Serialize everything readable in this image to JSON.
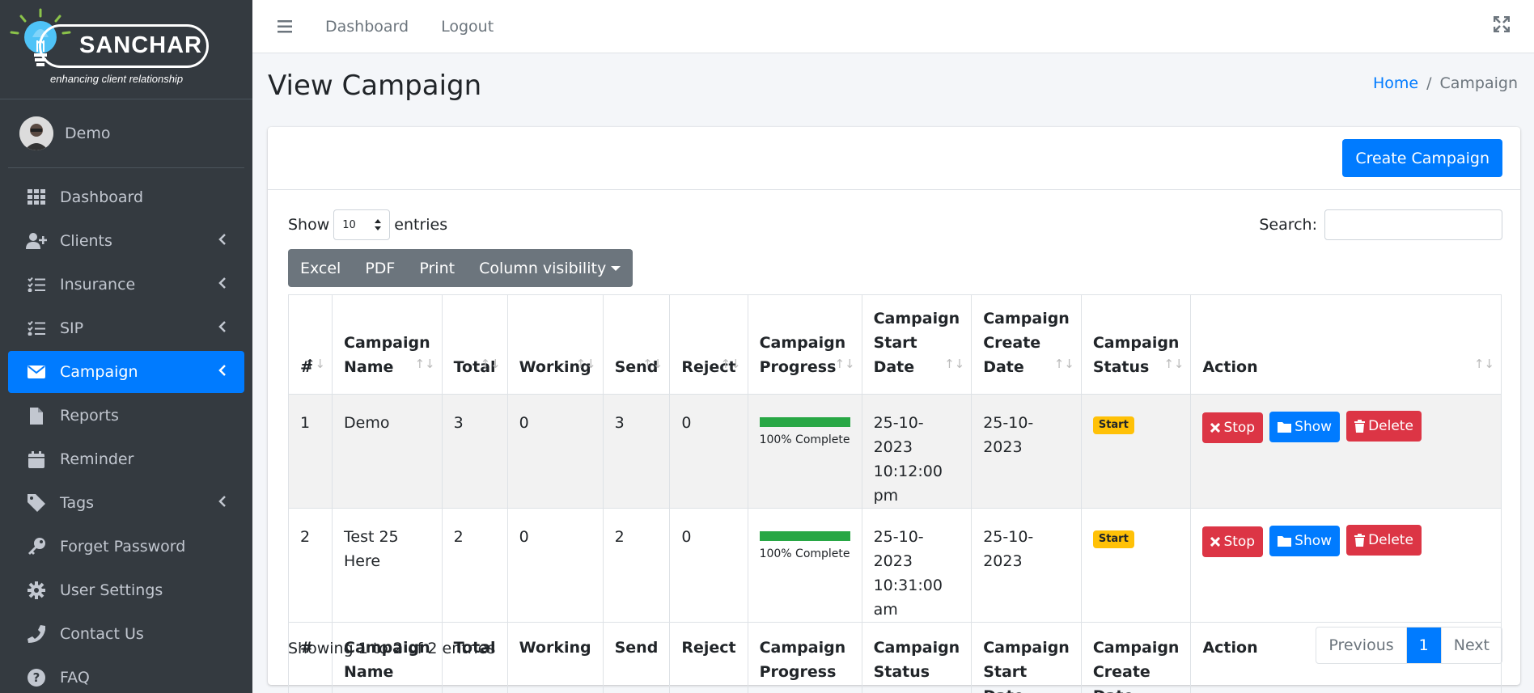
{
  "brand": {
    "name": "SANCHAR",
    "tagline": "enhancing client relationship"
  },
  "user": {
    "name": "Demo"
  },
  "sidebar": {
    "items": [
      {
        "label": "Dashboard"
      },
      {
        "label": "Clients"
      },
      {
        "label": "Insurance"
      },
      {
        "label": "SIP"
      },
      {
        "label": "Campaign"
      },
      {
        "label": "Reports"
      },
      {
        "label": "Reminder"
      },
      {
        "label": "Tags"
      },
      {
        "label": "Forget Password"
      },
      {
        "label": "User Settings"
      },
      {
        "label": "Contact Us"
      },
      {
        "label": "FAQ"
      }
    ]
  },
  "topbar": {
    "links": [
      "Dashboard",
      "Logout"
    ]
  },
  "page": {
    "title": "View Campaign"
  },
  "breadcrumb": {
    "home": "Home",
    "current": "Campaign"
  },
  "card": {
    "create_button": "Create Campaign"
  },
  "controls": {
    "show_label": "Show",
    "entries_value": "10",
    "entries_label": "entries",
    "search_label": "Search:",
    "search_value": ""
  },
  "buttons": {
    "excel": "Excel",
    "pdf": "PDF",
    "print": "Print",
    "colvis": "Column visibility"
  },
  "table": {
    "headers": [
      "#",
      "Campaign Name",
      "Total",
      "Working",
      "Send",
      "Reject",
      "Campaign Progress",
      "Campaign Start Date",
      "Campaign Create Date",
      "Campaign Status",
      "Action"
    ],
    "footers": [
      "#",
      "Campaign Name",
      "Total",
      "Working",
      "Send",
      "Reject",
      "Campaign Progress",
      "Campaign Status",
      "Campaign Start Date",
      "Campaign Create Date",
      "Action"
    ],
    "rows": [
      {
        "num": "1",
        "name": "Demo",
        "total": "3",
        "working": "0",
        "send": "3",
        "reject": "0",
        "progress": 100,
        "progress_label": "100% Complete",
        "start_date": "25-10-2023",
        "start_time": "10:12:00 pm",
        "create_date": "25-10-2023",
        "status": "Start"
      },
      {
        "num": "2",
        "name": "Test 25 Here",
        "total": "2",
        "working": "0",
        "send": "2",
        "reject": "0",
        "progress": 100,
        "progress_label": "100% Complete",
        "start_date": "25-10-2023",
        "start_time": "10:31:00 am",
        "create_date": "25-10-2023",
        "status": "Start"
      }
    ],
    "actions": {
      "stop": "Stop",
      "show": "Show",
      "delete": "Delete"
    }
  },
  "footer": {
    "showing": "Showing 1 to 2 of 2 entries"
  },
  "pagination": {
    "previous": "Previous",
    "current": "1",
    "next": "Next"
  },
  "colors": {
    "primary": "#007bff",
    "danger": "#dc3545",
    "success": "#28a745",
    "warning": "#ffc107",
    "sidebar": "#343a40"
  }
}
